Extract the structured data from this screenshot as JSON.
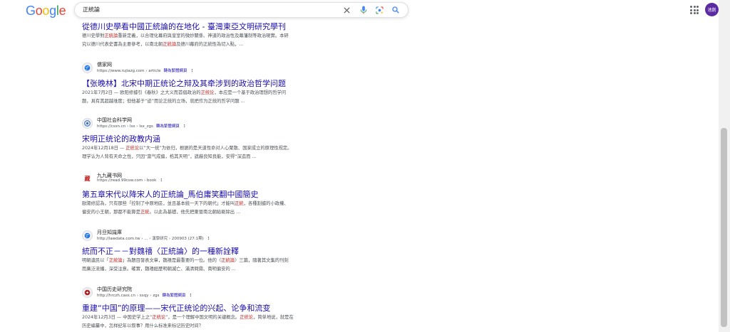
{
  "header": {
    "logo": "Google",
    "logo_colors": [
      "#4285F4",
      "#EA4335",
      "#FBBC05",
      "#4285F4",
      "#34A853",
      "#EA4335"
    ],
    "query": "正統論",
    "avatar_label": "池剴",
    "avatar_color": "#5b2aa3"
  },
  "results": [
    {
      "title": "從德川史學看中國正統論的在地化 - 臺灣東亞文明研究學刊",
      "snippet_line1_a": "德川史學對",
      "snippet_line1_hl": "正統論",
      "snippet_line1_b": "重新定義，以合理化幕府與皇室的微妙關係、神道的政治性及幕藩制等政治現實。本研",
      "snippet_line2_a": "究以德川代表史書為主要參考，以南北朝",
      "snippet_line2_hl": "正統論",
      "snippet_line2_b": "及德川幕府的正統性為切入點，..."
    },
    {
      "site": "儒家网",
      "url": "https://www.rujiazg.com › article",
      "translate": "轉為繁體網頁",
      "title": "【张晚林】北宋中期正统论之辩及其牵涉到的政治哲学问题",
      "snippet_line1_a": "2021年7月2日 — 欧阳修據引《春秋》之大义而首倡政治的",
      "snippet_line1_hl": "正统论",
      "snippet_line1_b": "，本应是一个基于政治理想的哲学问",
      "snippet_line2": "题，具有其超越维度；但他基于“迹”而论正统的立场，就把作为正统的哲学问题 ..."
    },
    {
      "site": "中国社会科学网",
      "url": "https://cssn.cn › lsx › lsx_zgs",
      "translate": "轉為繁體網頁",
      "title": "宋明正统论的政教内涵",
      "snippet_line1_a": "2024年12月18日 — ",
      "snippet_line1_hl": "正统论",
      "snippet_line1_b": "以“大一统”为依归，根据的是天道性命对人心聚散、国家成立的原理性规定。",
      "snippet_line2": "理学认为人背有天命之性，只因“禀气成偏，梏其天明”，遮蔽良知良能，安得“深造而 ..."
    },
    {
      "site": "九九藏书网",
      "url": "https://read.99csw.com › book",
      "favicon_text": "藏",
      "title": "第五章宋代以降宋人的正統論_馬伯庸笑翻中國簡史",
      "snippet_line1_a": "歐陽修認為，只有那些「控制了中原地區，並且基本統一天下的朝代」才能叫",
      "snippet_line1_hl": "正統",
      "snippet_line1_b": "，各種割據的小政權、",
      "snippet_line2_a": "偏安的小王朝，那都不能算是",
      "snippet_line2_hl": "正統",
      "snippet_line2_b": "。以此為基礎，他先把東晉南北朝給剔除出 ..."
    },
    {
      "site": "月旦知識庫",
      "url": "http://lawdata.com.tw › ... › 漢學研究 › 200903 (27:1期)",
      "title": "統而不正－－對魏禧〈正統論〉的一種新詮釋",
      "snippet_line1_a": "明朝遺民以「",
      "snippet_line1_hl": "正統論",
      "snippet_line1_b": "」為題目發表文章，魏禧是最重要的一位。他的〈",
      "snippet_line1_hl2": "正統論",
      "snippet_line1_c": "〉三篇，隨著其文集的刊刻",
      "snippet_line2": "而廣泛流播，深受注意。確實，魏禧經歷明朝滅亡、滿清問鼎、南明偏安的 ..."
    },
    {
      "site": "中国历史研究院",
      "url": "http://hrczh.cass.cn › sxqy › zgs",
      "translate": "轉為繁體網頁",
      "title": "重建“中国”的原理——宋代正统论的兴起、论争和流变",
      "snippet_line1_a": "2024年12月3日 — 中国史学上之“",
      "snippet_line1_hl": "正统论",
      "snippet_line1_b": "”，是一个理解中国文明的关键概念。",
      "snippet_line1_hl2": "正统论",
      "snippet_line1_c": "，简单地说，就是在",
      "snippet_line2": "历史编纂中，怎样纪年以叙事？用什么标准来标记历史时间？"
    }
  ]
}
